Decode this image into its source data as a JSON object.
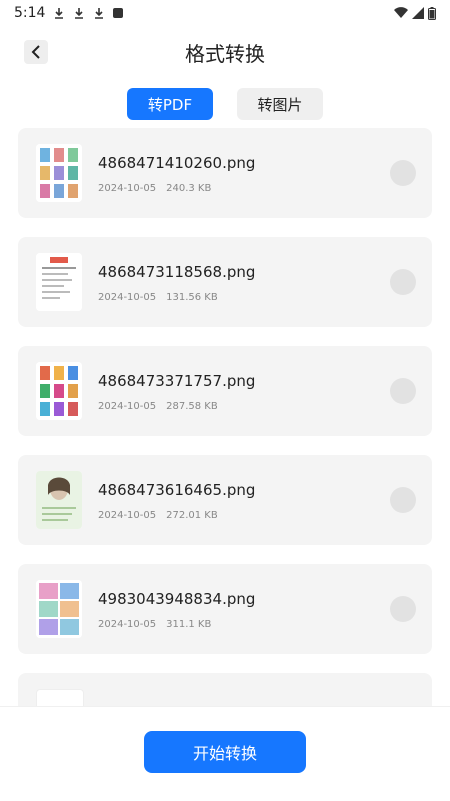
{
  "status_bar": {
    "time": "5:14"
  },
  "header": {
    "title": "格式转换"
  },
  "tabs": [
    {
      "label": "转PDF"
    },
    {
      "label": "转图片"
    }
  ],
  "files": [
    {
      "name": "4868471410260.png",
      "date": "2024-10-05",
      "size": "240.3 KB",
      "thumb": "thumb-grid-icon"
    },
    {
      "name": "4868473118568.png",
      "date": "2024-10-05",
      "size": "131.56 KB",
      "thumb": "thumb-document-icon"
    },
    {
      "name": "4868473371757.png",
      "date": "2024-10-05",
      "size": "287.58 KB",
      "thumb": "thumb-poster-grid-icon"
    },
    {
      "name": "4868473616465.png",
      "date": "2024-10-05",
      "size": "272.01 KB",
      "thumb": "thumb-portrait-icon"
    },
    {
      "name": "4983043948834.png",
      "date": "2024-10-05",
      "size": "311.1 KB",
      "thumb": "thumb-art-grid-icon"
    }
  ],
  "bottom": {
    "start_label": "开始转换"
  },
  "colors": {
    "accent": "#1677ff",
    "card_bg": "#f4f4f4"
  }
}
